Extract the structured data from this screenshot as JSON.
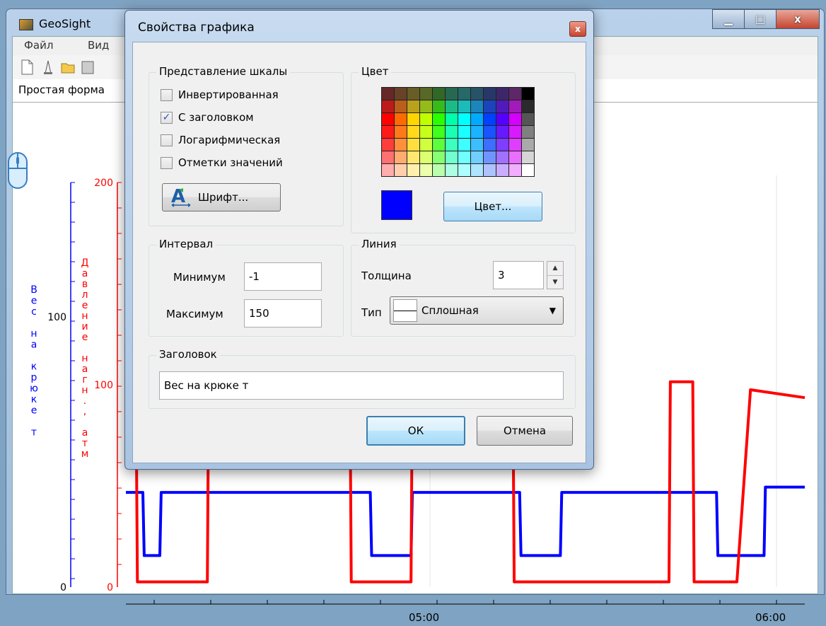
{
  "window": {
    "title": "GeoSight",
    "menu": [
      "Файл",
      "Вид"
    ],
    "tab_label": "Простая форма",
    "controls": {
      "minimize": "▁",
      "maximize": "□",
      "close": "x"
    }
  },
  "chart_data": {
    "type": "line",
    "title": "",
    "x_ticks": [
      "05:00",
      "06:00"
    ],
    "axes": [
      {
        "label": "Вес на крюке т",
        "color": "#0000ff",
        "ticks": [
          "0",
          "100"
        ],
        "ylim": [
          -1,
          150
        ]
      },
      {
        "label": "Давление нагн., атм",
        "color": "#ff0000",
        "ticks": [
          "0",
          "100",
          "200"
        ],
        "ylim": [
          0,
          200
        ]
      }
    ],
    "series": [
      {
        "name": "Вес на крюке т",
        "color": "#0000ff",
        "points": [
          [
            0,
            36
          ],
          [
            0.025,
            36
          ],
          [
            0.027,
            12
          ],
          [
            0.05,
            12
          ],
          [
            0.052,
            36
          ],
          [
            0.36,
            36
          ],
          [
            0.362,
            12
          ],
          [
            0.42,
            12
          ],
          [
            0.422,
            36
          ],
          [
            0.58,
            36
          ],
          [
            0.582,
            12
          ],
          [
            0.64,
            12
          ],
          [
            0.642,
            36
          ],
          [
            0.87,
            36
          ],
          [
            0.872,
            12
          ],
          [
            0.94,
            12
          ],
          [
            0.942,
            38
          ],
          [
            1,
            38
          ]
        ]
      },
      {
        "name": "Давление нагн., атм",
        "color": "#ff0000",
        "points": [
          [
            0,
            72
          ],
          [
            0.015,
            72
          ],
          [
            0.017,
            2
          ],
          [
            0.12,
            2
          ],
          [
            0.122,
            78
          ],
          [
            0.33,
            78
          ],
          [
            0.332,
            2
          ],
          [
            0.42,
            2
          ],
          [
            0.422,
            78
          ],
          [
            0.57,
            78
          ],
          [
            0.572,
            2
          ],
          [
            0.8,
            2
          ],
          [
            0.802,
            78
          ],
          [
            0.835,
            78
          ],
          [
            0.837,
            2
          ],
          [
            0.9,
            2
          ],
          [
            0.92,
            75
          ],
          [
            1,
            72
          ]
        ]
      }
    ]
  },
  "dialog": {
    "title": "Свойства графика",
    "close": "x",
    "scale_group": {
      "label": "Представление шкалы",
      "options": [
        {
          "label": "Инвертированная",
          "checked": false
        },
        {
          "label": "С заголовком",
          "checked": true
        },
        {
          "label": "Логарифмическая",
          "checked": false
        },
        {
          "label": "Отметки значений",
          "checked": false
        }
      ],
      "font_button": "Шрифт..."
    },
    "color_group": {
      "label": "Цвет",
      "current": "#0000ff",
      "color_button": "Цвет..."
    },
    "interval_group": {
      "label": "Интервал",
      "min_label": "Минимум",
      "min_value": "-1",
      "max_label": "Максимум",
      "max_value": "150"
    },
    "line_group": {
      "label": "Линия",
      "thickness_label": "Толщина",
      "thickness_value": "3",
      "type_label": "Тип",
      "type_value": "Сплошная"
    },
    "title_group": {
      "label": "Заголовок",
      "value": "Вес на крюке т"
    },
    "ok_label": "ОК",
    "cancel_label": "Отмена"
  }
}
